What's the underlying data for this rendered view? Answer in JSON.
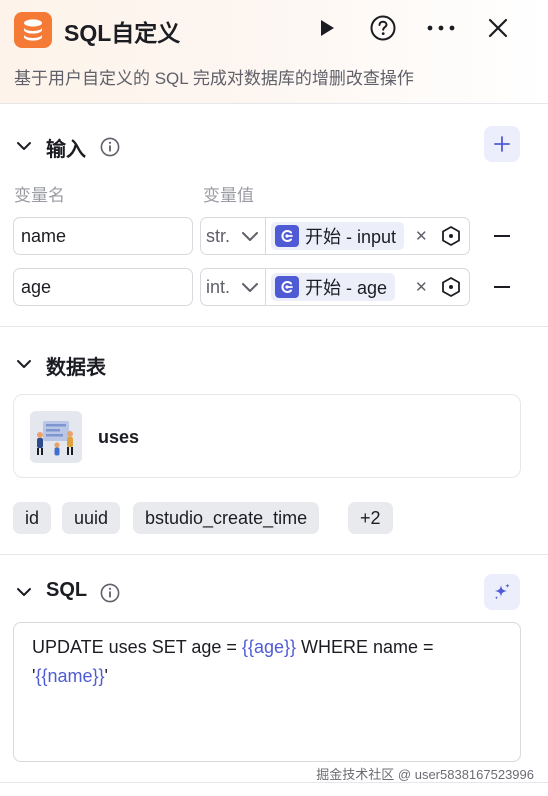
{
  "header": {
    "title": "SQL自定义",
    "description": "基于用户自定义的 SQL 完成对数据库的增删改查操作",
    "icon": "database-icon",
    "accent_color": "#f57a36"
  },
  "input_section": {
    "title": "输入",
    "col_name_label": "变量名",
    "col_value_label": "变量值",
    "rows": [
      {
        "name": "name",
        "type": "str.",
        "ref": "开始 - input"
      },
      {
        "name": "age",
        "type": "int.",
        "ref": "开始 - age"
      }
    ]
  },
  "table_section": {
    "title": "数据表",
    "table_name": "uses",
    "fields": [
      "id",
      "uuid",
      "bstudio_create_time",
      "+2"
    ]
  },
  "sql_section": {
    "title": "SQL",
    "line1_prefix": "UPDATE uses SET age = ",
    "line1_var": "{{age}}",
    "line1_suffix": " WHERE name =",
    "line2_prefix": "'",
    "line2_var": "{{name}}",
    "line2_suffix": "'"
  },
  "watermark": "掘金技术社区 @ user5838167523996",
  "colors": {
    "brand": "#4f5bd5",
    "accent": "#f57a36"
  }
}
